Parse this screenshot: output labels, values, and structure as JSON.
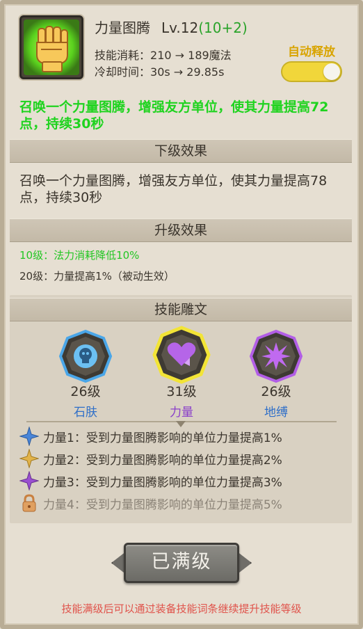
{
  "skill": {
    "icon": "fist-icon",
    "name": "力量图腾",
    "level": "Lv.12",
    "bonus": "(10+2)",
    "cost_label": "技能消耗：",
    "cost_value": "210 → 189魔法",
    "cooldown_label": "冷却时间：",
    "cooldown_value": "30s → 29.85s",
    "auto_label": "自动释放",
    "auto_enabled": true,
    "description": "召唤一个力量图腾，增强友方单位，使其力量提高72点，持续30秒"
  },
  "next_level": {
    "header": "下级效果",
    "description": "召唤一个力量图腾，增强友方单位，使其力量提高78点，持续30秒"
  },
  "upgrade": {
    "header": "升级效果",
    "lines": [
      {
        "text": "10级：法力消耗降低10%",
        "color": "#23c623"
      },
      {
        "text": "20级：力量提高1%（被动生效）",
        "color": "#3a342c"
      }
    ]
  },
  "runes": {
    "header": "技能雕文",
    "items": [
      {
        "level": "26级",
        "name": "石肤",
        "icon": "skull-icon",
        "glow": "#4aa6e8",
        "color": "#2f6fc8"
      },
      {
        "level": "31级",
        "name": "力量",
        "icon": "heart-icon",
        "glow": "#f2e436",
        "color": "#8a3fc9"
      },
      {
        "level": "26级",
        "name": "地缚",
        "icon": "burst-icon",
        "glow": "#b25ee6",
        "color": "#2f6fc8"
      }
    ],
    "effects": [
      {
        "text": "力量1：受到力量图腾影响的单位力量提高1%",
        "icon": "blue-star-icon",
        "color": "#4a86d8",
        "locked": false
      },
      {
        "text": "力量2：受到力量图腾影响的单位力量提高2%",
        "icon": "gold-star-icon",
        "color": "#d9a93a",
        "locked": false
      },
      {
        "text": "力量3：受到力量图腾影响的单位力量提高3%",
        "icon": "purple-star-icon",
        "color": "#9a4fd0",
        "locked": false
      },
      {
        "text": "力量4：受到力量图腾影响的单位力量提高5%",
        "icon": "lock-icon",
        "color": "#d99550",
        "locked": true
      }
    ]
  },
  "button_label": "已满级",
  "footer": "技能满级后可以通过装备技能词条继续提升技能等级"
}
